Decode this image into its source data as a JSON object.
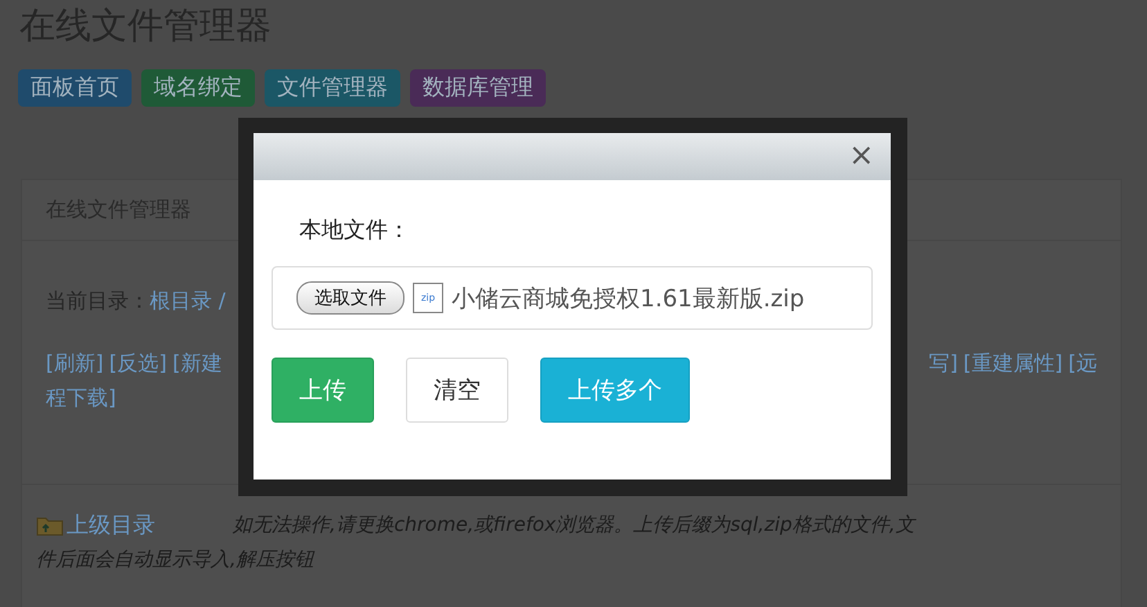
{
  "page_title": "在线文件管理器",
  "nav_buttons": [
    {
      "label": "面板首页",
      "color": "#1f4b6c"
    },
    {
      "label": "域名绑定",
      "color": "#1f5a37"
    },
    {
      "label": "文件管理器",
      "color": "#1b5766"
    },
    {
      "label": "数据库管理",
      "color": "#4a2b57"
    }
  ],
  "panel": {
    "heading": "在线文件管理器",
    "current_dir_label": "当前目录：",
    "current_dir_link": "根目录 /",
    "toolbar_left": [
      "[刷新]",
      "[反选]",
      "[新建"
    ],
    "toolbar_right": [
      "写]",
      "[重建属性]",
      "[远"
    ],
    "toolbar_wrap": "程下载]",
    "parent_link": "上级目录",
    "note_lines": [
      "如无法操作,请更换chrome,或firefox浏览器。上传后缀为sql,zip格式的文件,文",
      "件后面会自动显示导入,解压按钮"
    ]
  },
  "dialog": {
    "close": "×",
    "field_label": "本地文件：",
    "choose_button": "选取文件",
    "file_icon_text": "zip",
    "file_name": "小储云商城免授权1.61最新版.zip",
    "buttons": [
      {
        "label": "上传",
        "kind": "success"
      },
      {
        "label": "清空",
        "kind": "default"
      },
      {
        "label": "上传多个",
        "kind": "info"
      }
    ]
  }
}
